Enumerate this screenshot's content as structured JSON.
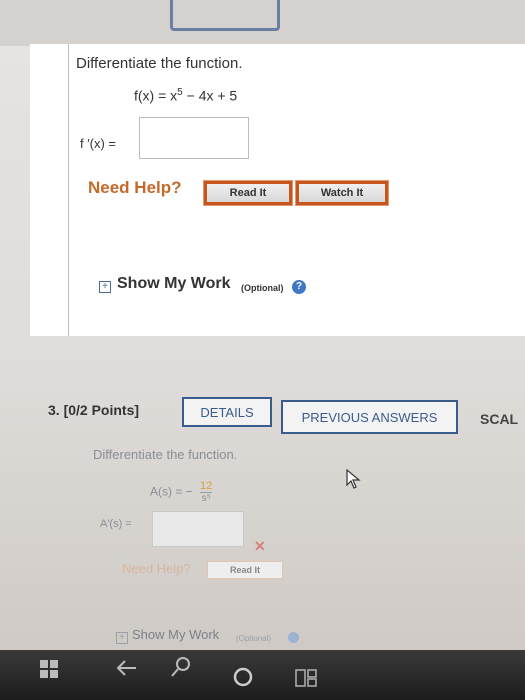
{
  "question2": {
    "prompt": "Differentiate the function.",
    "function_text": "f(x) = x",
    "function_exp": "5",
    "function_rest": " − 4x + 5",
    "derivative_label": "f ′(x) =",
    "answer_value": "",
    "need_help": "Need Help?",
    "read_it": "Read It",
    "watch_it": "Watch It",
    "show_my_work": "Show My Work",
    "optional": "(Optional)",
    "help_glyph": "?"
  },
  "question3": {
    "number": "3.",
    "points": "[0/2 Points]",
    "details": "DETAILS",
    "previous_answers": "PREVIOUS ANSWERS",
    "scale_partial": "SCAL",
    "prompt": "Differentiate the function.",
    "function_lhs": "A(s) = −",
    "frac_num": "12",
    "frac_den": "s⁵",
    "derivative_label": "A′(s) =",
    "answer_value": "",
    "cross": "✕",
    "need_help": "Need Help?",
    "read_it": "Read It",
    "show_my_work": "Show My Work",
    "optional": "(Optional)"
  },
  "colors": {
    "need_help": "#c46a2b",
    "button_border": "#c8551d",
    "outline_button": "#3b5b8c",
    "help_icon": "#3f79c6"
  },
  "icons": {
    "expand": "plus-box-icon",
    "help": "question-circle-icon",
    "cursor": "mouse-pointer-icon",
    "taskbar": [
      "windows-icon",
      "back-arrow-icon",
      "search-icon",
      "home-icon",
      "task-view-icon"
    ]
  }
}
